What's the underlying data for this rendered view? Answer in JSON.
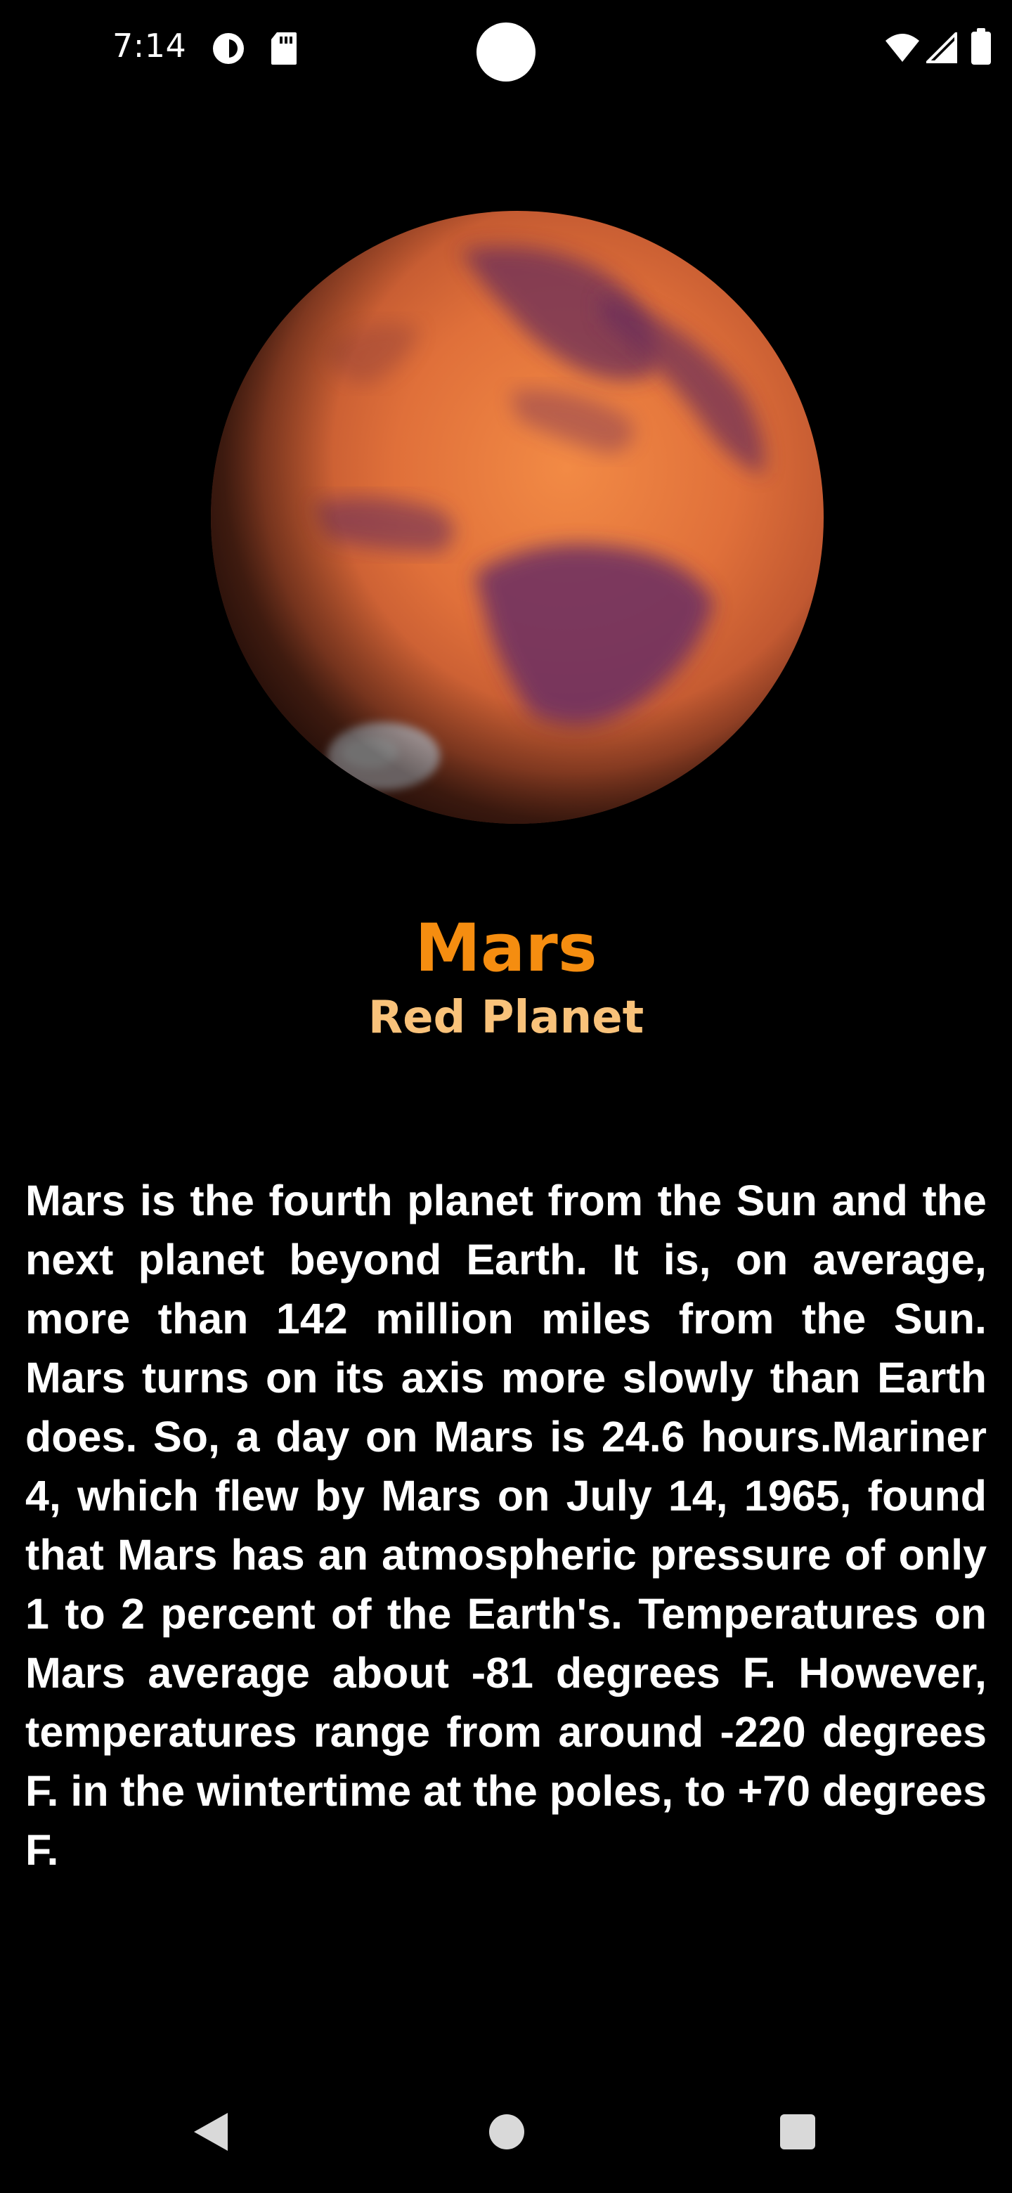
{
  "status_bar": {
    "time": "7:14",
    "icons": [
      "data-saver-icon",
      "sd-card-icon",
      "wifi-icon",
      "signal-icon",
      "battery-icon"
    ]
  },
  "planet": {
    "image": "mars-planet-image",
    "name": "Mars",
    "subtitle": "Red Planet",
    "description": "Mars is the fourth planet from the Sun and the next planet beyond Earth. It is, on average, more than 142 million miles from the Sun. Mars turns on its axis more slowly than Earth does. So, a day on Mars is 24.6 hours.Mariner 4, which flew by Mars on July 14, 1965, found that Mars has an atmospheric pressure of only 1 to 2 percent of the Earth's. Temperatures on Mars average about -81 degrees F. However, temperatures range from around -220 degrees F. in the wintertime at the poles, to +70 degrees F."
  },
  "nav_bar": {
    "icons": [
      "back-icon",
      "home-icon",
      "recents-icon"
    ]
  },
  "colors": {
    "background": "#000000",
    "title": "#f58d10",
    "subtitle": "#f9c27a",
    "text": "#ffffff"
  }
}
